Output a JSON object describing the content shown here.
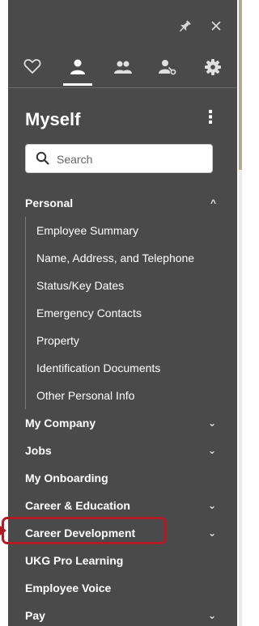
{
  "header": {
    "pin_icon": "pin-icon",
    "close_icon": "close-icon"
  },
  "tabs": [
    {
      "icon": "heart-icon",
      "active": false
    },
    {
      "icon": "person-icon",
      "active": true
    },
    {
      "icon": "people-icon",
      "active": false
    },
    {
      "icon": "person-key-icon",
      "active": false
    },
    {
      "icon": "gear-icon",
      "active": false
    }
  ],
  "panel": {
    "title": "Myself",
    "menu_icon": "kebab-icon"
  },
  "search": {
    "placeholder": "Search"
  },
  "nav": {
    "personal": {
      "label": "Personal",
      "expanded": true,
      "children": [
        "Employee Summary",
        "Name, Address, and Telephone",
        "Status/Key Dates",
        "Emergency Contacts",
        "Property",
        "Identification Documents",
        "Other Personal Info"
      ]
    },
    "items": [
      {
        "label": "My Company",
        "expandable": true
      },
      {
        "label": "Jobs",
        "expandable": true
      },
      {
        "label": "My Onboarding",
        "expandable": false
      },
      {
        "label": "Career & Education",
        "expandable": true
      },
      {
        "label": "Career Development",
        "expandable": true
      },
      {
        "label": "UKG Pro Learning",
        "expandable": false,
        "highlighted": true
      },
      {
        "label": "Employee Voice",
        "expandable": false
      },
      {
        "label": "Pay",
        "expandable": true
      }
    ]
  },
  "colors": {
    "panel_bg": "#4a4a4a",
    "highlight": "#b01c24",
    "text": "#ffffff"
  }
}
